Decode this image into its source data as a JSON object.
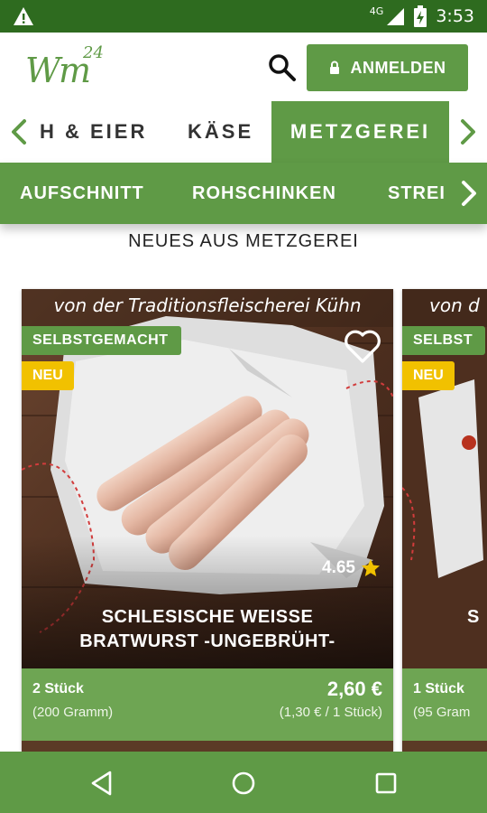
{
  "status_bar": {
    "network": "4G",
    "time": "3:53",
    "warning_icon": "warning-triangle-icon"
  },
  "header": {
    "logo_text": "Wm",
    "logo_sup": "24",
    "login_label": "ANMELDEN"
  },
  "categories": [
    {
      "label": "H & EIER",
      "active": false
    },
    {
      "label": "KÄSE",
      "active": false
    },
    {
      "label": "METZGEREI",
      "active": true
    }
  ],
  "subcategories": [
    {
      "label": "AUFSCHNITT"
    },
    {
      "label": "ROHSCHINKEN"
    },
    {
      "label": "STREI"
    }
  ],
  "section_title": "NEUES AUS METZGEREI",
  "products": [
    {
      "origin": "von der Traditionsfleischerei Kühn",
      "badge_homemade": "SELBSTGEMACHT",
      "badge_new": "NEU",
      "rating": "4.65",
      "name_line1": "SCHLESISCHE WEISSE",
      "name_line2": "BRATWURST -UNGEBRÜHT-",
      "quantity": "2 Stück",
      "weight": "(200 Gramm)",
      "price": "2,60 €",
      "unit_price": "(1,30 € / 1 Stück)"
    },
    {
      "origin": "von d",
      "badge_homemade": "SELBST",
      "badge_new": "NEU",
      "name_line1": "S",
      "quantity": "1 Stück",
      "weight": "(95 Gram"
    }
  ],
  "colors": {
    "brand_green": "#5f9a46",
    "status_green": "#2e6b1f",
    "badge_yellow": "#f1c100"
  }
}
